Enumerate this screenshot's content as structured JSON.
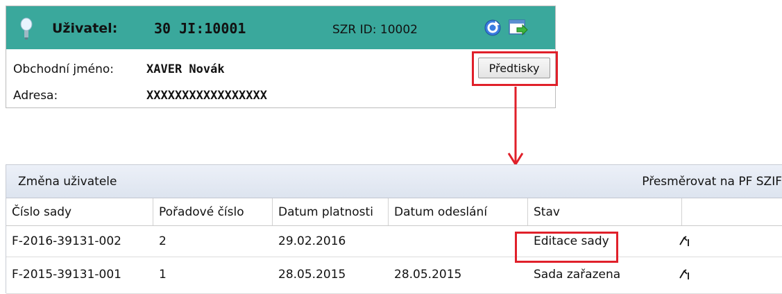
{
  "user_panel": {
    "label": "Uživatel:",
    "code": "30 JI:10001",
    "szr_id": "SZR ID: 10002",
    "business_name_label": "Obchodní jméno:",
    "business_name_value": "XAVER Novák",
    "address_label": "Adresa:",
    "address_value": "XXXXXXXXXXXXXXXXX",
    "preprints_button": "Předtisky",
    "icons": [
      "lightbulb-icon",
      "refresh-icon",
      "redirect-window-icon"
    ],
    "header_color": "#3aa89c"
  },
  "highlight_color": "#e0202a",
  "grid": {
    "toolbar_left": "Změna uživatele",
    "toolbar_right": "Přesměrovat na PF SZIF",
    "columns": [
      "Číslo sady",
      "Pořadové číslo",
      "Datum platnosti",
      "Datum odeslání",
      "Stav",
      ""
    ],
    "rows": [
      {
        "cislo_sady": "F-2016-39131-002",
        "poradove_cislo": "2",
        "datum_platnosti": "29.02.2016",
        "datum_odeslani": "",
        "stav": "Editace sady",
        "action_icon": "edit-icon"
      },
      {
        "cislo_sady": "F-2015-39131-001",
        "poradove_cislo": "1",
        "datum_platnosti": "28.05.2015",
        "datum_odeslani": "28.05.2015",
        "stav": "Sada zařazena",
        "action_icon": "edit-icon"
      }
    ]
  }
}
